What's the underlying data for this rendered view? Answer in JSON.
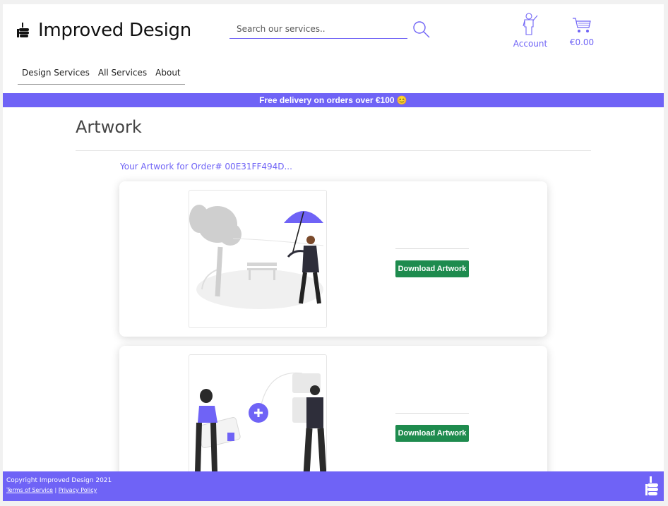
{
  "brand": {
    "name": "Improved Design",
    "icon": "thumbs-up-icon"
  },
  "search": {
    "placeholder": "Search our services..",
    "icon": "search-icon"
  },
  "account": {
    "label": "Account",
    "icon": "person-icon"
  },
  "cart": {
    "total": "€0.00",
    "icon": "cart-icon"
  },
  "nav": {
    "items": [
      {
        "label": "Design Services"
      },
      {
        "label": "All Services"
      },
      {
        "label": "About"
      }
    ]
  },
  "banner": {
    "text": "Free delivery on orders over €100 😊"
  },
  "main": {
    "title": "Artwork",
    "order_link": "Your Artwork for Order# 00E31FF494D...",
    "cards": [
      {
        "button_label": "Download Artwork",
        "image": "person-with-umbrella-in-park-illustration"
      },
      {
        "button_label": "Download Artwork",
        "image": "two-people-adding-content-illustration"
      }
    ]
  },
  "footer": {
    "copyright": "Copyright Improved Design 2021",
    "terms": "Terms of Service",
    "separator": "|",
    "privacy": "Privacy Policy"
  },
  "colors": {
    "accent": "#6f63f6",
    "download": "#1e8b4e"
  }
}
